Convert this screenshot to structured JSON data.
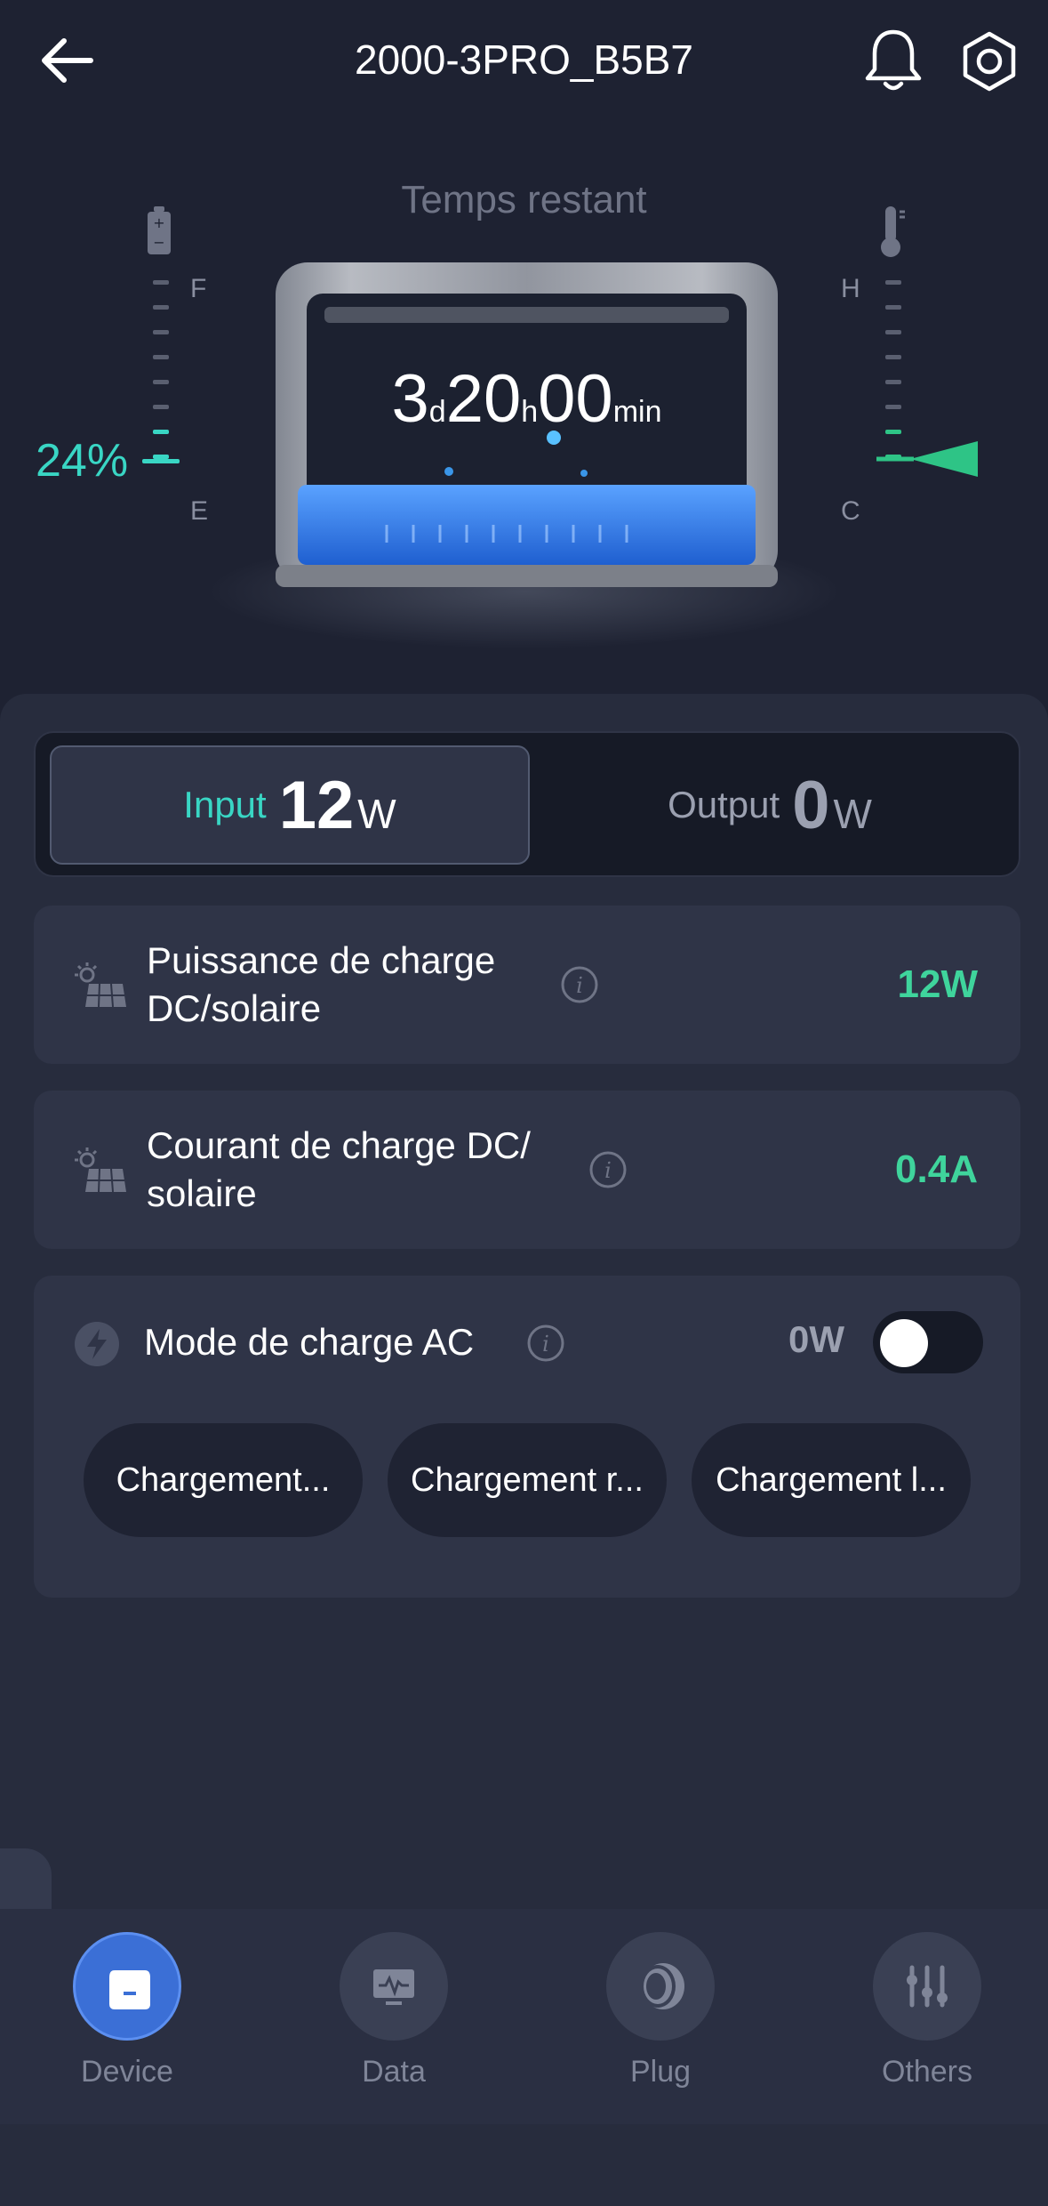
{
  "header": {
    "title": "2000-3PRO_B5B7"
  },
  "status": {
    "remaining_label": "Temps restant",
    "timer": {
      "days": "3",
      "days_unit": "d",
      "hours": "20",
      "hours_unit": "h",
      "minutes": "00",
      "minutes_unit": "min"
    },
    "battery_percent": "24%",
    "battery_gauge": {
      "full_label": "F",
      "empty_label": "E",
      "level": 0.24
    },
    "temp_gauge": {
      "hot_label": "H",
      "cold_label": "C"
    }
  },
  "power_toggle": {
    "input_label": "Input",
    "input_value": "12",
    "input_unit": "W",
    "output_label": "Output",
    "output_value": "0",
    "output_unit": "W"
  },
  "cards": {
    "dc_power": {
      "title_line1": "Puissance de charge",
      "title_line2": "DC/solaire",
      "value": "12W"
    },
    "dc_current": {
      "title_line1": "Courant de charge DC/",
      "title_line2": "solaire",
      "value": "0.4A"
    },
    "ac_mode": {
      "title": "Mode de charge AC",
      "value": "0W",
      "enabled": false,
      "options": [
        "Chargement...",
        "Chargement r...",
        "Chargement l..."
      ]
    }
  },
  "nav": {
    "items": [
      {
        "label": "Device"
      },
      {
        "label": "Data"
      },
      {
        "label": "Plug"
      },
      {
        "label": "Others"
      }
    ]
  },
  "colors": {
    "accent_teal": "#39d6c4",
    "value_green": "#3fd49c",
    "active_blue": "#3b6fd6"
  }
}
